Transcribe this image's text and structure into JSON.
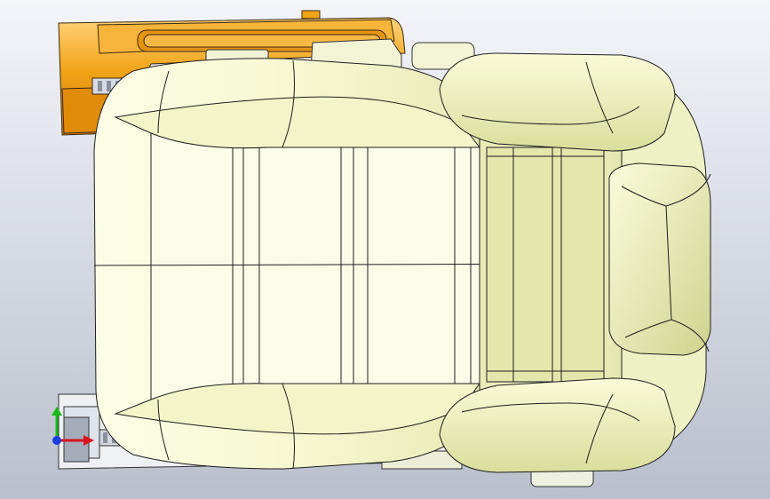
{
  "viewport": {
    "background_top": "#f4f5f9",
    "background_bottom": "#b9bfcc"
  },
  "model": {
    "seat_cushion_color": "#f6f7cf",
    "seat_shadow_color": "#dfe3a4",
    "edge_color": "#1e1e1e",
    "rail_color": "#f2a418",
    "rail_dark_color": "#c77a05",
    "rail_bottom_color": "#f1f2f4"
  },
  "triad": {
    "x_axis_color": "#d8141e",
    "y_axis_color": "#19b919",
    "z_axis_color": "#1a3ee0",
    "icons": [
      "x-axis-arrow",
      "y-axis-arrow",
      "z-axis-dot"
    ]
  }
}
